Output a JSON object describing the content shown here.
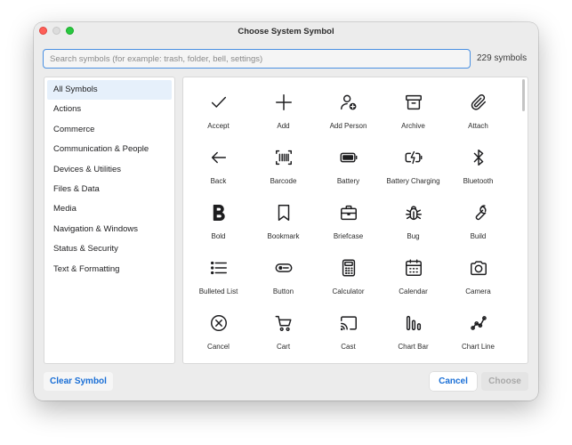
{
  "window": {
    "title": "Choose System Symbol"
  },
  "search": {
    "placeholder": "Search symbols (for example: trash, folder, bell, settings)",
    "value": "",
    "count_label": "229 symbols"
  },
  "sidebar": {
    "items": [
      {
        "label": "All Symbols",
        "selected": true
      },
      {
        "label": "Actions"
      },
      {
        "label": "Commerce"
      },
      {
        "label": "Communication & People"
      },
      {
        "label": "Devices & Utilities"
      },
      {
        "label": "Files & Data"
      },
      {
        "label": "Media"
      },
      {
        "label": "Navigation & Windows"
      },
      {
        "label": "Status & Security"
      },
      {
        "label": "Text & Formatting"
      }
    ]
  },
  "symbols": [
    {
      "label": "Accept",
      "icon": "check-icon"
    },
    {
      "label": "Add",
      "icon": "plus-icon"
    },
    {
      "label": "Add Person",
      "icon": "add-person-icon"
    },
    {
      "label": "Archive",
      "icon": "archive-icon"
    },
    {
      "label": "Attach",
      "icon": "paperclip-icon"
    },
    {
      "label": "Back",
      "icon": "arrow-left-icon"
    },
    {
      "label": "Barcode",
      "icon": "barcode-icon"
    },
    {
      "label": "Battery",
      "icon": "battery-icon"
    },
    {
      "label": "Battery Charging",
      "icon": "battery-charging-icon"
    },
    {
      "label": "Bluetooth",
      "icon": "bluetooth-icon"
    },
    {
      "label": "Bold",
      "icon": "bold-icon"
    },
    {
      "label": "Bookmark",
      "icon": "bookmark-icon"
    },
    {
      "label": "Briefcase",
      "icon": "briefcase-icon"
    },
    {
      "label": "Bug",
      "icon": "bug-icon"
    },
    {
      "label": "Build",
      "icon": "wrench-icon"
    },
    {
      "label": "Bulleted List",
      "icon": "bulleted-list-icon"
    },
    {
      "label": "Button",
      "icon": "button-icon"
    },
    {
      "label": "Calculator",
      "icon": "calculator-icon"
    },
    {
      "label": "Calendar",
      "icon": "calendar-icon"
    },
    {
      "label": "Camera",
      "icon": "camera-icon"
    },
    {
      "label": "Cancel",
      "icon": "cancel-circle-icon"
    },
    {
      "label": "Cart",
      "icon": "cart-icon"
    },
    {
      "label": "Cast",
      "icon": "cast-icon"
    },
    {
      "label": "Chart Bar",
      "icon": "chart-bar-icon"
    },
    {
      "label": "Chart Line",
      "icon": "chart-line-icon"
    }
  ],
  "footer": {
    "clear_label": "Clear Symbol",
    "cancel_label": "Cancel",
    "choose_label": "Choose"
  },
  "colors": {
    "accent": "#1a6fd6",
    "focus_ring": "#4a90e2",
    "selected_row": "#e6f0fb"
  }
}
